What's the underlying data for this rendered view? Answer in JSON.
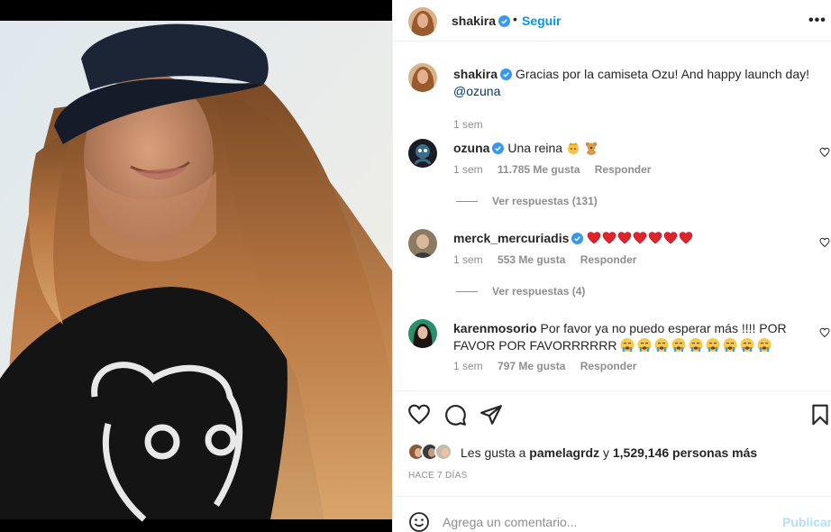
{
  "post": {
    "image_alt": "Selfie of a woman with long hair wearing a navy cap and black t-shirt with a bear print"
  },
  "header": {
    "username": "shakira",
    "dot": "•",
    "follow_label": "Seguir",
    "more_label": "•••",
    "avatar_icon": "avatar-shakira"
  },
  "caption": {
    "username": "shakira",
    "text": "Gracias por la camiseta Ozu! And happy launch day!",
    "mention": "@ozuna",
    "time": "1 sem"
  },
  "comments": [
    {
      "username": "ozuna",
      "verified": true,
      "text": "Una reina",
      "emojis": [
        "queen-emoji",
        "teddy-bear-emoji"
      ],
      "time": "1 sem",
      "likes": "11.785 Me gusta",
      "reply_label": "Responder",
      "replies": "Ver respuestas (131)"
    },
    {
      "username": "merck_mercuriadis",
      "verified": true,
      "text": "",
      "emojis": [
        "red-heart-emoji",
        "red-heart-emoji",
        "red-heart-emoji",
        "red-heart-emoji",
        "red-heart-emoji",
        "red-heart-emoji",
        "red-heart-emoji"
      ],
      "time": "1 sem",
      "likes": "553 Me gusta",
      "reply_label": "Responder",
      "replies": "Ver respuestas (4)"
    },
    {
      "username": "karenmosorio",
      "verified": false,
      "text": "Por favor ya no puedo esperar más !!!! POR FAVOR POR FAVORRRRRR",
      "emojis": [
        "crying-face-emoji",
        "crying-face-emoji",
        "crying-face-emoji",
        "crying-face-emoji",
        "crying-face-emoji",
        "crying-face-emoji",
        "crying-face-emoji",
        "crying-face-emoji",
        "crying-face-emoji"
      ],
      "time": "1 sem",
      "likes": "797 Me gusta",
      "reply_label": "Responder"
    }
  ],
  "actions": {
    "icons": [
      "heart-icon",
      "comment-icon",
      "share-icon",
      "bookmark-icon"
    ]
  },
  "likes": {
    "prefix": "Les gusta a",
    "user": "pamelagrdz",
    "joiner": "y",
    "count": "1,529,146 personas más"
  },
  "time_ago": "HACE 7 DÍAS",
  "composer": {
    "placeholder": "Agrega un comentario...",
    "publish_label": "Publicar",
    "emoji_icon": "smiley-icon"
  },
  "colors": {
    "accent": "#0095f6",
    "verified": "#3897f0",
    "muted": "#8e8e8e",
    "publish_disabled": "#b2dffc",
    "heart_red": "#e0242d"
  }
}
